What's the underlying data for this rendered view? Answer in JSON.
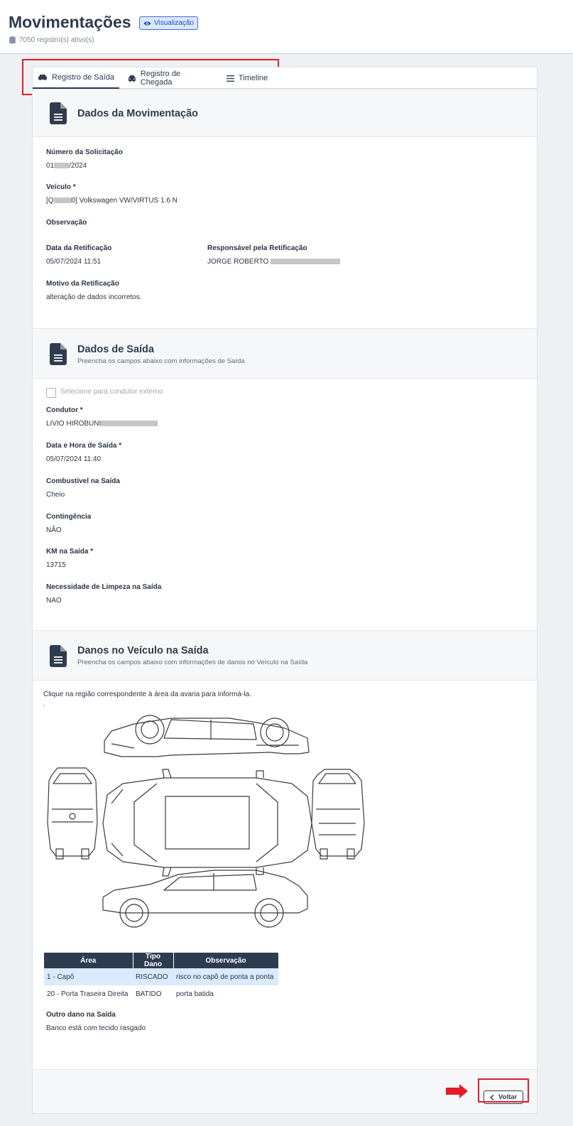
{
  "header": {
    "title": "Movimentações",
    "badge_label": "Visualização",
    "record_count": "7050 registro(s) ativo(s)"
  },
  "tabs": [
    {
      "label": "Registro de Saída",
      "active": true
    },
    {
      "label": "Registro de Chegada",
      "active": false
    },
    {
      "label": "Timeline",
      "active": false
    }
  ],
  "movimentacao": {
    "title": "Dados da Movimentação",
    "numero_label": "Número da Solicitação",
    "numero_prefix": "01",
    "numero_suffix": "/2024",
    "veiculo_label": "Veículo *",
    "veiculo_prefix": "[Q",
    "veiculo_suffix": "0] Volkswagen VW/VIRTUS 1.6 N",
    "observacao_label": "Observação",
    "data_retificacao_label": "Data da Retificação",
    "data_retificacao_value": "05/07/2024 11:51",
    "responsavel_label": "Responsável pela Retificação",
    "responsavel_value": "JORGE ROBERTO",
    "motivo_label": "Motivo da Retificação",
    "motivo_value": "alteração de dados incorretos."
  },
  "saida": {
    "title": "Dados de Saída",
    "subtitle": "Preencha os campos abaixo com informações de Saída",
    "externo_label": "Selecione para condutor externo",
    "condutor_label": "Condutor *",
    "condutor_value": "LIVIO HIROBUNI",
    "data_hora_label": "Data e Hora de Saída *",
    "data_hora_value": "05/07/2024 11:40",
    "combustivel_label": "Combustível na Saída",
    "combustivel_value": "Cheio",
    "contingencia_label": "Contingência",
    "contingencia_value": "NÃO",
    "km_label": "KM na Saída *",
    "km_value": "13715",
    "limpeza_label": "Necessidade de Limpeza na Saída",
    "limpeza_value": "NAO"
  },
  "danos": {
    "title": "Danos no Veículo na Saída",
    "subtitle": "Preencha os campos abaixo com informações de danos no Veículo na Saída",
    "instruction": "Clique na região correspondente à área da avaria para informá-la.",
    "dot": ".",
    "table_headers": [
      "Área",
      "Tipo Dano",
      "Observação"
    ],
    "rows": [
      {
        "area": "1 - Capô",
        "tipo": "RISCADO",
        "obs": "risco no capô de ponta a ponta"
      },
      {
        "area": "20 - Porta Traseira Direita",
        "tipo": "BATIDO",
        "obs": "porta batida"
      }
    ],
    "outro_label": "Outro dano na Saída",
    "outro_value": "Banco está com tecido rasgado"
  },
  "footer": {
    "back_label": "Voltar"
  },
  "colors": {
    "accent": "#2f3b4e",
    "highlight_box": "#e11d2a",
    "selected_row": "#dbeafc"
  }
}
